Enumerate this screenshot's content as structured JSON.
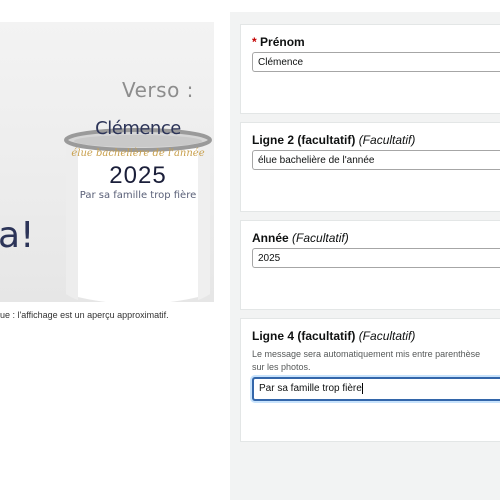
{
  "preview": {
    "verso_label": "Verso :",
    "mug_name": "Clémence",
    "mug_subtitle": "élue bachelière de l'année",
    "mug_year": "2025",
    "mug_family": "Par sa famille trop fière",
    "left_mug_text": "a!",
    "caption": "ue : l'affichage est un aperçu approximatif."
  },
  "form": {
    "prenom": {
      "required_mark": "*",
      "label": "Prénom",
      "value": "Clémence"
    },
    "ligne2": {
      "label": "Ligne 2 (facultatif)",
      "optional": "(Facultatif)",
      "value": "élue bachelière de l'année"
    },
    "annee": {
      "label": "Année",
      "optional": "(Facultatif)",
      "value": "2025"
    },
    "ligne4": {
      "label": "Ligne 4 (facultatif)",
      "optional": "(Facultatif)",
      "help_line1": "Le message sera automatiquement mis entre parenthèse",
      "help_line2": "sur les photos.",
      "value": "Par sa famille trop fière"
    }
  },
  "colors": {
    "required": "#c40000",
    "focus_border": "#3366aa",
    "mug_navy": "#2c3458",
    "mug_gold": "#c9a04d"
  }
}
